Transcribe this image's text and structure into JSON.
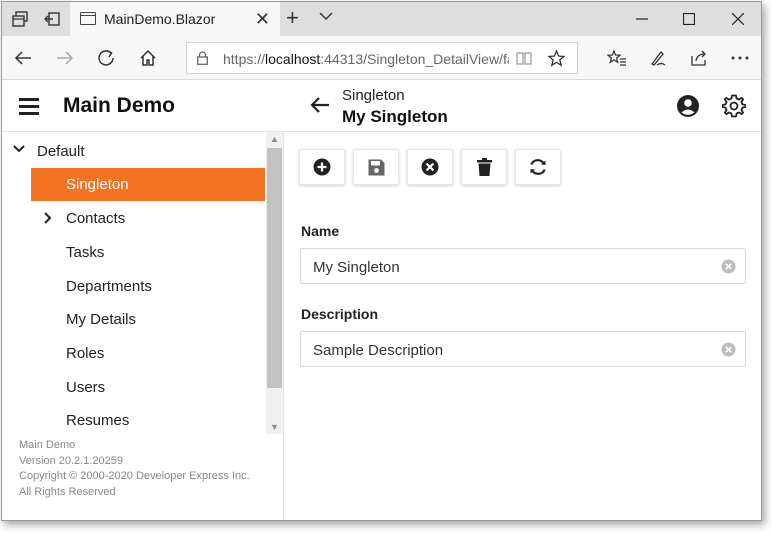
{
  "browser": {
    "tab_title": "MainDemo.Blazor",
    "url_prefix": "https://",
    "url_host": "localhost",
    "url_rest": ":44313/Singleton_DetailView/fa"
  },
  "app": {
    "title": "Main Demo",
    "breadcrumb_parent": "Singleton",
    "breadcrumb_current": "My Singleton",
    "accent_color": "#f47322"
  },
  "sidebar": {
    "root_label": "Default",
    "items": [
      {
        "label": "Singleton",
        "active": true
      },
      {
        "label": "Contacts",
        "expandable": true
      },
      {
        "label": "Tasks"
      },
      {
        "label": "Departments"
      },
      {
        "label": "My Details"
      },
      {
        "label": "Roles"
      },
      {
        "label": "Users"
      },
      {
        "label": "Resumes"
      }
    ],
    "footer": {
      "line1": "Main Demo",
      "line2": "Version 20.2.1.20259",
      "line3": "Copyright © 2000-2020 Developer Express Inc.",
      "line4": "All Rights Reserved"
    }
  },
  "toolbar": {
    "buttons": [
      "new-icon",
      "save-icon",
      "cancel-icon",
      "delete-icon",
      "refresh-icon"
    ]
  },
  "form": {
    "name_label": "Name",
    "name_value": "My Singleton",
    "description_label": "Description",
    "description_value": "Sample Description"
  }
}
